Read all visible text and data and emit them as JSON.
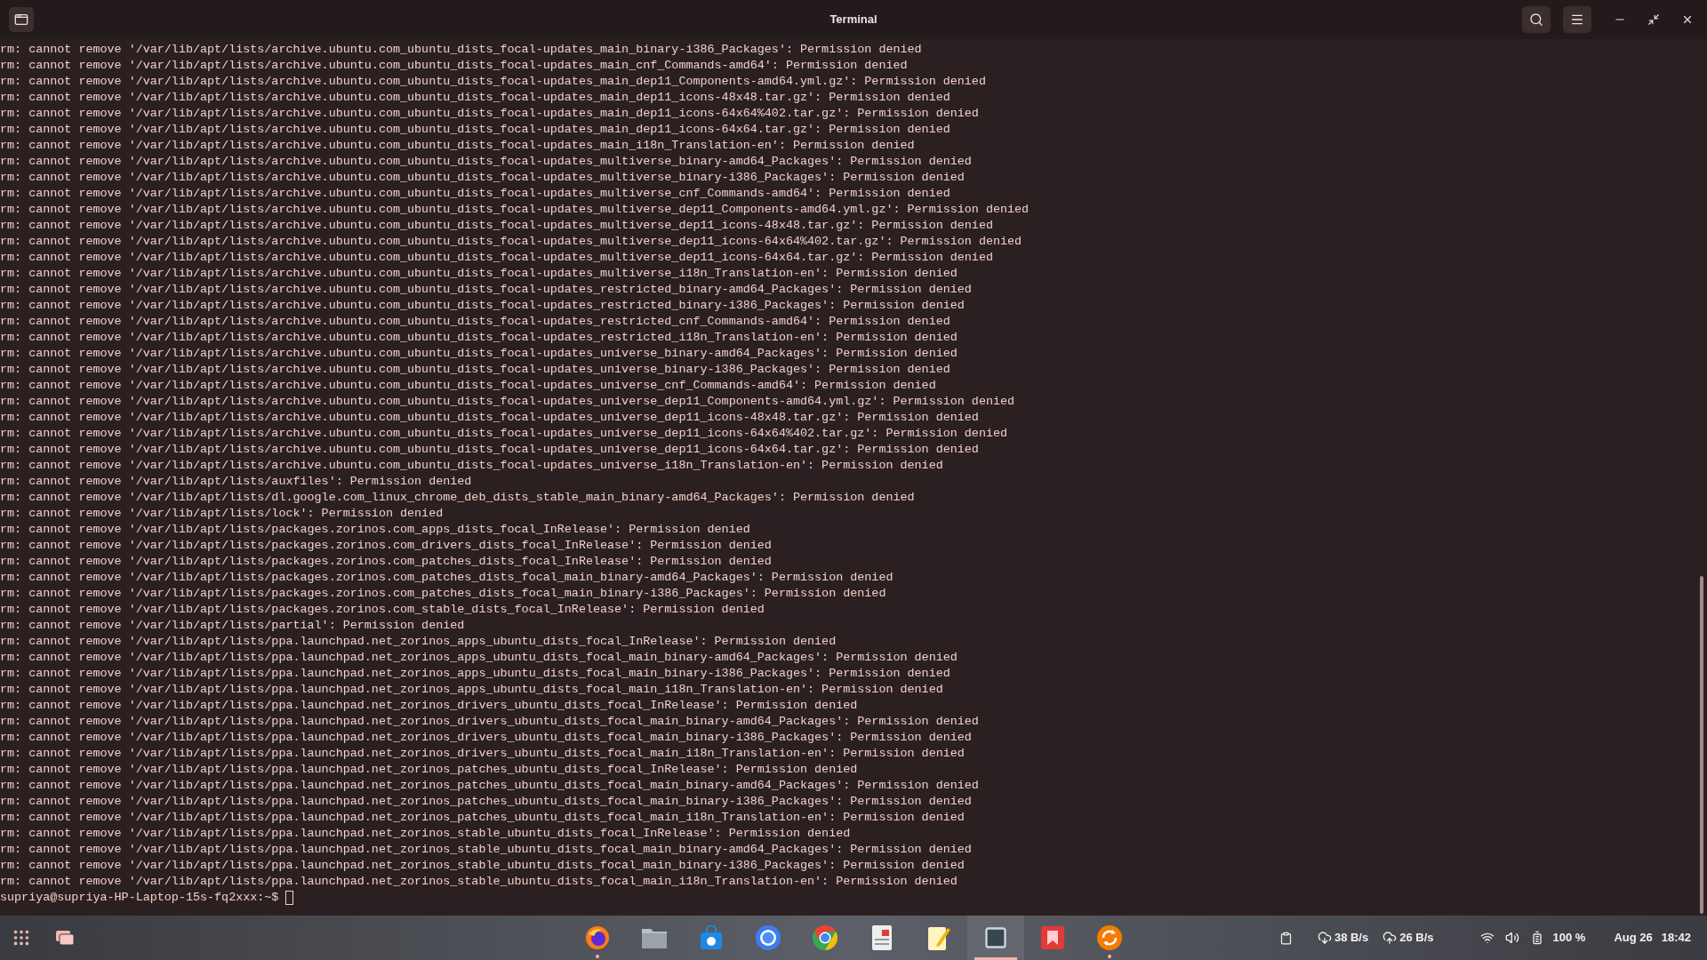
{
  "window": {
    "title": "Terminal"
  },
  "terminal": {
    "lines": [
      "rm: cannot remove '/var/lib/apt/lists/archive.ubuntu.com_ubuntu_dists_focal-updates_main_binary-i386_Packages': Permission denied",
      "rm: cannot remove '/var/lib/apt/lists/archive.ubuntu.com_ubuntu_dists_focal-updates_main_cnf_Commands-amd64': Permission denied",
      "rm: cannot remove '/var/lib/apt/lists/archive.ubuntu.com_ubuntu_dists_focal-updates_main_dep11_Components-amd64.yml.gz': Permission denied",
      "rm: cannot remove '/var/lib/apt/lists/archive.ubuntu.com_ubuntu_dists_focal-updates_main_dep11_icons-48x48.tar.gz': Permission denied",
      "rm: cannot remove '/var/lib/apt/lists/archive.ubuntu.com_ubuntu_dists_focal-updates_main_dep11_icons-64x64%402.tar.gz': Permission denied",
      "rm: cannot remove '/var/lib/apt/lists/archive.ubuntu.com_ubuntu_dists_focal-updates_main_dep11_icons-64x64.tar.gz': Permission denied",
      "rm: cannot remove '/var/lib/apt/lists/archive.ubuntu.com_ubuntu_dists_focal-updates_main_i18n_Translation-en': Permission denied",
      "rm: cannot remove '/var/lib/apt/lists/archive.ubuntu.com_ubuntu_dists_focal-updates_multiverse_binary-amd64_Packages': Permission denied",
      "rm: cannot remove '/var/lib/apt/lists/archive.ubuntu.com_ubuntu_dists_focal-updates_multiverse_binary-i386_Packages': Permission denied",
      "rm: cannot remove '/var/lib/apt/lists/archive.ubuntu.com_ubuntu_dists_focal-updates_multiverse_cnf_Commands-amd64': Permission denied",
      "rm: cannot remove '/var/lib/apt/lists/archive.ubuntu.com_ubuntu_dists_focal-updates_multiverse_dep11_Components-amd64.yml.gz': Permission denied",
      "rm: cannot remove '/var/lib/apt/lists/archive.ubuntu.com_ubuntu_dists_focal-updates_multiverse_dep11_icons-48x48.tar.gz': Permission denied",
      "rm: cannot remove '/var/lib/apt/lists/archive.ubuntu.com_ubuntu_dists_focal-updates_multiverse_dep11_icons-64x64%402.tar.gz': Permission denied",
      "rm: cannot remove '/var/lib/apt/lists/archive.ubuntu.com_ubuntu_dists_focal-updates_multiverse_dep11_icons-64x64.tar.gz': Permission denied",
      "rm: cannot remove '/var/lib/apt/lists/archive.ubuntu.com_ubuntu_dists_focal-updates_multiverse_i18n_Translation-en': Permission denied",
      "rm: cannot remove '/var/lib/apt/lists/archive.ubuntu.com_ubuntu_dists_focal-updates_restricted_binary-amd64_Packages': Permission denied",
      "rm: cannot remove '/var/lib/apt/lists/archive.ubuntu.com_ubuntu_dists_focal-updates_restricted_binary-i386_Packages': Permission denied",
      "rm: cannot remove '/var/lib/apt/lists/archive.ubuntu.com_ubuntu_dists_focal-updates_restricted_cnf_Commands-amd64': Permission denied",
      "rm: cannot remove '/var/lib/apt/lists/archive.ubuntu.com_ubuntu_dists_focal-updates_restricted_i18n_Translation-en': Permission denied",
      "rm: cannot remove '/var/lib/apt/lists/archive.ubuntu.com_ubuntu_dists_focal-updates_universe_binary-amd64_Packages': Permission denied",
      "rm: cannot remove '/var/lib/apt/lists/archive.ubuntu.com_ubuntu_dists_focal-updates_universe_binary-i386_Packages': Permission denied",
      "rm: cannot remove '/var/lib/apt/lists/archive.ubuntu.com_ubuntu_dists_focal-updates_universe_cnf_Commands-amd64': Permission denied",
      "rm: cannot remove '/var/lib/apt/lists/archive.ubuntu.com_ubuntu_dists_focal-updates_universe_dep11_Components-amd64.yml.gz': Permission denied",
      "rm: cannot remove '/var/lib/apt/lists/archive.ubuntu.com_ubuntu_dists_focal-updates_universe_dep11_icons-48x48.tar.gz': Permission denied",
      "rm: cannot remove '/var/lib/apt/lists/archive.ubuntu.com_ubuntu_dists_focal-updates_universe_dep11_icons-64x64%402.tar.gz': Permission denied",
      "rm: cannot remove '/var/lib/apt/lists/archive.ubuntu.com_ubuntu_dists_focal-updates_universe_dep11_icons-64x64.tar.gz': Permission denied",
      "rm: cannot remove '/var/lib/apt/lists/archive.ubuntu.com_ubuntu_dists_focal-updates_universe_i18n_Translation-en': Permission denied",
      "rm: cannot remove '/var/lib/apt/lists/auxfiles': Permission denied",
      "rm: cannot remove '/var/lib/apt/lists/dl.google.com_linux_chrome_deb_dists_stable_main_binary-amd64_Packages': Permission denied",
      "rm: cannot remove '/var/lib/apt/lists/lock': Permission denied",
      "rm: cannot remove '/var/lib/apt/lists/packages.zorinos.com_apps_dists_focal_InRelease': Permission denied",
      "rm: cannot remove '/var/lib/apt/lists/packages.zorinos.com_drivers_dists_focal_InRelease': Permission denied",
      "rm: cannot remove '/var/lib/apt/lists/packages.zorinos.com_patches_dists_focal_InRelease': Permission denied",
      "rm: cannot remove '/var/lib/apt/lists/packages.zorinos.com_patches_dists_focal_main_binary-amd64_Packages': Permission denied",
      "rm: cannot remove '/var/lib/apt/lists/packages.zorinos.com_patches_dists_focal_main_binary-i386_Packages': Permission denied",
      "rm: cannot remove '/var/lib/apt/lists/packages.zorinos.com_stable_dists_focal_InRelease': Permission denied",
      "rm: cannot remove '/var/lib/apt/lists/partial': Permission denied",
      "rm: cannot remove '/var/lib/apt/lists/ppa.launchpad.net_zorinos_apps_ubuntu_dists_focal_InRelease': Permission denied",
      "rm: cannot remove '/var/lib/apt/lists/ppa.launchpad.net_zorinos_apps_ubuntu_dists_focal_main_binary-amd64_Packages': Permission denied",
      "rm: cannot remove '/var/lib/apt/lists/ppa.launchpad.net_zorinos_apps_ubuntu_dists_focal_main_binary-i386_Packages': Permission denied",
      "rm: cannot remove '/var/lib/apt/lists/ppa.launchpad.net_zorinos_apps_ubuntu_dists_focal_main_i18n_Translation-en': Permission denied",
      "rm: cannot remove '/var/lib/apt/lists/ppa.launchpad.net_zorinos_drivers_ubuntu_dists_focal_InRelease': Permission denied",
      "rm: cannot remove '/var/lib/apt/lists/ppa.launchpad.net_zorinos_drivers_ubuntu_dists_focal_main_binary-amd64_Packages': Permission denied",
      "rm: cannot remove '/var/lib/apt/lists/ppa.launchpad.net_zorinos_drivers_ubuntu_dists_focal_main_binary-i386_Packages': Permission denied",
      "rm: cannot remove '/var/lib/apt/lists/ppa.launchpad.net_zorinos_drivers_ubuntu_dists_focal_main_i18n_Translation-en': Permission denied",
      "rm: cannot remove '/var/lib/apt/lists/ppa.launchpad.net_zorinos_patches_ubuntu_dists_focal_InRelease': Permission denied",
      "rm: cannot remove '/var/lib/apt/lists/ppa.launchpad.net_zorinos_patches_ubuntu_dists_focal_main_binary-amd64_Packages': Permission denied",
      "rm: cannot remove '/var/lib/apt/lists/ppa.launchpad.net_zorinos_patches_ubuntu_dists_focal_main_binary-i386_Packages': Permission denied",
      "rm: cannot remove '/var/lib/apt/lists/ppa.launchpad.net_zorinos_patches_ubuntu_dists_focal_main_i18n_Translation-en': Permission denied",
      "rm: cannot remove '/var/lib/apt/lists/ppa.launchpad.net_zorinos_stable_ubuntu_dists_focal_InRelease': Permission denied",
      "rm: cannot remove '/var/lib/apt/lists/ppa.launchpad.net_zorinos_stable_ubuntu_dists_focal_main_binary-amd64_Packages': Permission denied",
      "rm: cannot remove '/var/lib/apt/lists/ppa.launchpad.net_zorinos_stable_ubuntu_dists_focal_main_binary-i386_Packages': Permission denied",
      "rm: cannot remove '/var/lib/apt/lists/ppa.launchpad.net_zorinos_stable_ubuntu_dists_focal_main_i18n_Translation-en': Permission denied"
    ],
    "prompt": "supriya@supriya-HP-Laptop-15s-fq2xxx:~$"
  },
  "taskbar": {
    "apps": [
      {
        "kind": "firefox",
        "running": true,
        "active": false
      },
      {
        "kind": "files",
        "running": false,
        "active": false
      },
      {
        "kind": "store",
        "running": false,
        "active": false
      },
      {
        "kind": "chromium",
        "running": false,
        "active": false
      },
      {
        "kind": "chrome",
        "running": false,
        "active": false
      },
      {
        "kind": "document",
        "running": false,
        "active": false
      },
      {
        "kind": "editor",
        "running": false,
        "active": false
      },
      {
        "kind": "terminal",
        "running": true,
        "active": true
      },
      {
        "kind": "bookmark",
        "running": false,
        "active": false
      },
      {
        "kind": "updater",
        "running": true,
        "active": false
      }
    ],
    "download": "38 B/s",
    "upload": "26 B/s",
    "battery": "100 %",
    "date": "Aug 26",
    "time": "18:42"
  }
}
